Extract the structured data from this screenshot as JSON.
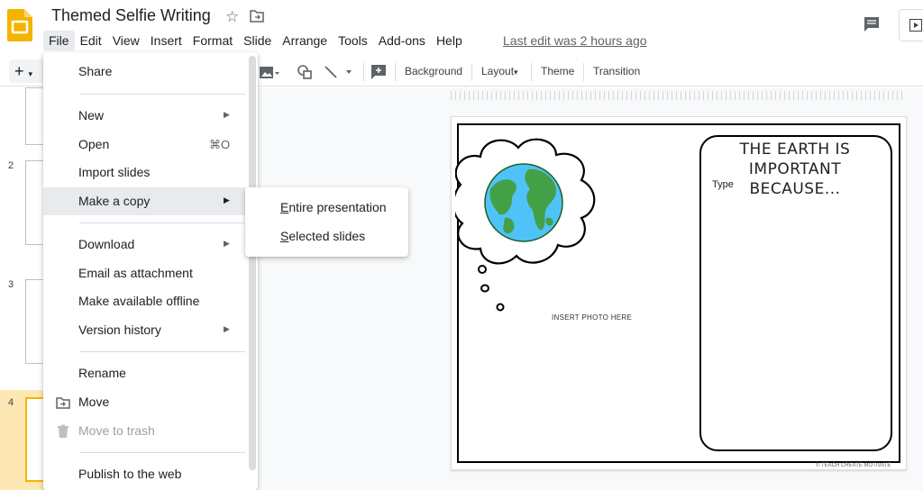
{
  "header": {
    "doc_title": "Themed Selfie Writing",
    "last_edit": "Last edit was 2 hours ago"
  },
  "menubar": [
    "File",
    "Edit",
    "View",
    "Insert",
    "Format",
    "Slide",
    "Arrange",
    "Tools",
    "Add-ons",
    "Help"
  ],
  "toolbar": {
    "add": "+",
    "background": "Background",
    "layout": "Layout",
    "theme": "Theme",
    "transition": "Transition"
  },
  "filmstrip": {
    "slide_numbers": [
      "2",
      "3",
      "4"
    ]
  },
  "file_menu": {
    "share": "Share",
    "new": "New",
    "open": "Open",
    "open_shortcut": "⌘O",
    "import_slides": "Import slides",
    "make_a_copy": "Make a copy",
    "download": "Download",
    "email_attachment": "Email as attachment",
    "make_offline": "Make available offline",
    "version_history": "Version history",
    "rename": "Rename",
    "move": "Move",
    "move_to_trash": "Move to trash",
    "publish": "Publish to the web"
  },
  "copy_submenu": {
    "entire_first": "E",
    "entire_rest": "ntire presentation",
    "selected_first": "S",
    "selected_rest": "elected slides"
  },
  "slide": {
    "card_title_line1": "THE EARTH IS IMPORTANT",
    "card_title_line2": "BECAUSE...",
    "card_placeholder": "Type",
    "photo_placeholder": "INSERT PHOTO HERE",
    "copyright": "© TEACH CREATE MOTIVATE"
  },
  "colors": {
    "menu_hover": "#e8eaed",
    "filmstrip_selected": "#fde7b2",
    "slides_logo": "#f4b400",
    "earth_ocean": "#4fc3f7",
    "earth_land": "#43a047"
  }
}
